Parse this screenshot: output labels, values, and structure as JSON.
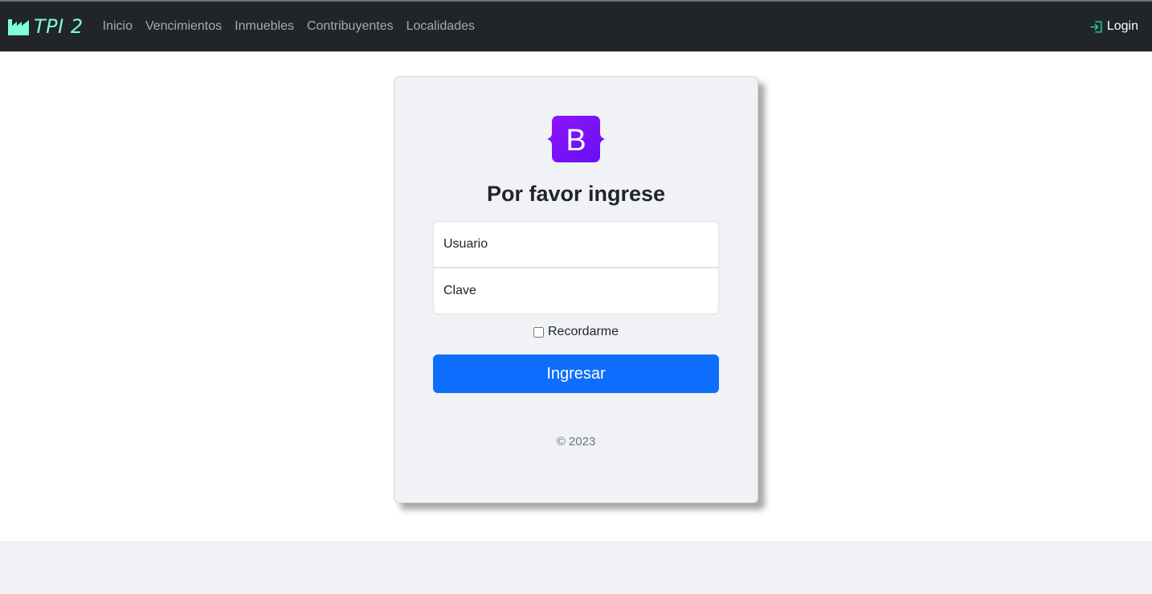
{
  "navbar": {
    "brand": "TPI 2",
    "links": [
      "Inicio",
      "Vencimientos",
      "Inmuebles",
      "Contribuyentes",
      "Localidades"
    ],
    "login_label": "Login"
  },
  "login_card": {
    "title": "Por favor ingrese",
    "username_placeholder": "Usuario",
    "password_placeholder": "Clave",
    "remember_label": "Recordarme",
    "remember_checked": false,
    "submit_label": "Ingresar",
    "copyright": "© 2023"
  },
  "colors": {
    "navbar_bg": "#212529",
    "brand_accent": "#7fffd4",
    "primary_button": "#0d6efd",
    "logo_purple": "#7b2ff7"
  }
}
